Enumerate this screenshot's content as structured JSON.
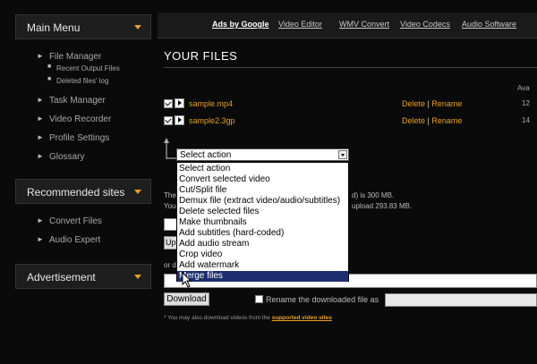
{
  "sidebar": {
    "main_menu": {
      "title": "Main Menu"
    },
    "items": [
      {
        "label": "File Manager"
      },
      {
        "label": "Recent Output Files"
      },
      {
        "label": "Deleted files' log"
      },
      {
        "label": "Task Manager"
      },
      {
        "label": "Video Recorder"
      },
      {
        "label": "Profile Settings"
      },
      {
        "label": "Glossary"
      }
    ],
    "recommended": {
      "title": "Recommended sites",
      "items": [
        {
          "label": "Convert Files"
        },
        {
          "label": "Audio Expert"
        }
      ]
    },
    "advertisement": {
      "title": "Advertisement"
    }
  },
  "topbar": {
    "ads": "Ads by Google",
    "links": [
      "Video Editor",
      "WMV Convert",
      "Video Codecs",
      "Audio Software"
    ]
  },
  "main": {
    "title": "YOUR FILES",
    "avail_header": "Ava",
    "files": [
      {
        "name": "sample.mp4",
        "delete": "Delete",
        "sep": "|",
        "rename": "Rename",
        "num": "12"
      },
      {
        "name": "sample2.3gp",
        "delete": "Delete",
        "sep": "|",
        "rename": "Rename",
        "num": "14"
      }
    ],
    "select": {
      "value": "Select action",
      "options": [
        "Select action",
        "Convert selected video",
        "Cut/Split file",
        "Demux file (extract video/audio/subtitles)",
        "Delete selected files",
        "Make thumbnails",
        "Add subtitles (hard-coded)",
        "Add audio stream",
        "Crop video",
        "Add watermark",
        "Merge files"
      ],
      "highlighted": "Merge files"
    },
    "partial_text": {
      "line1_left": "The",
      "line1_right": "d) is 300 MB.",
      "line2_left": "You",
      "line2_right": "upload 293.83 MB.",
      "upload_btn": "Up",
      "or_label": "or d"
    },
    "download_button": "Download",
    "rename_label": "Rename the downloaded file as",
    "note_prefix": "* You may also download videos from the",
    "note_link": "supported video sites"
  }
}
